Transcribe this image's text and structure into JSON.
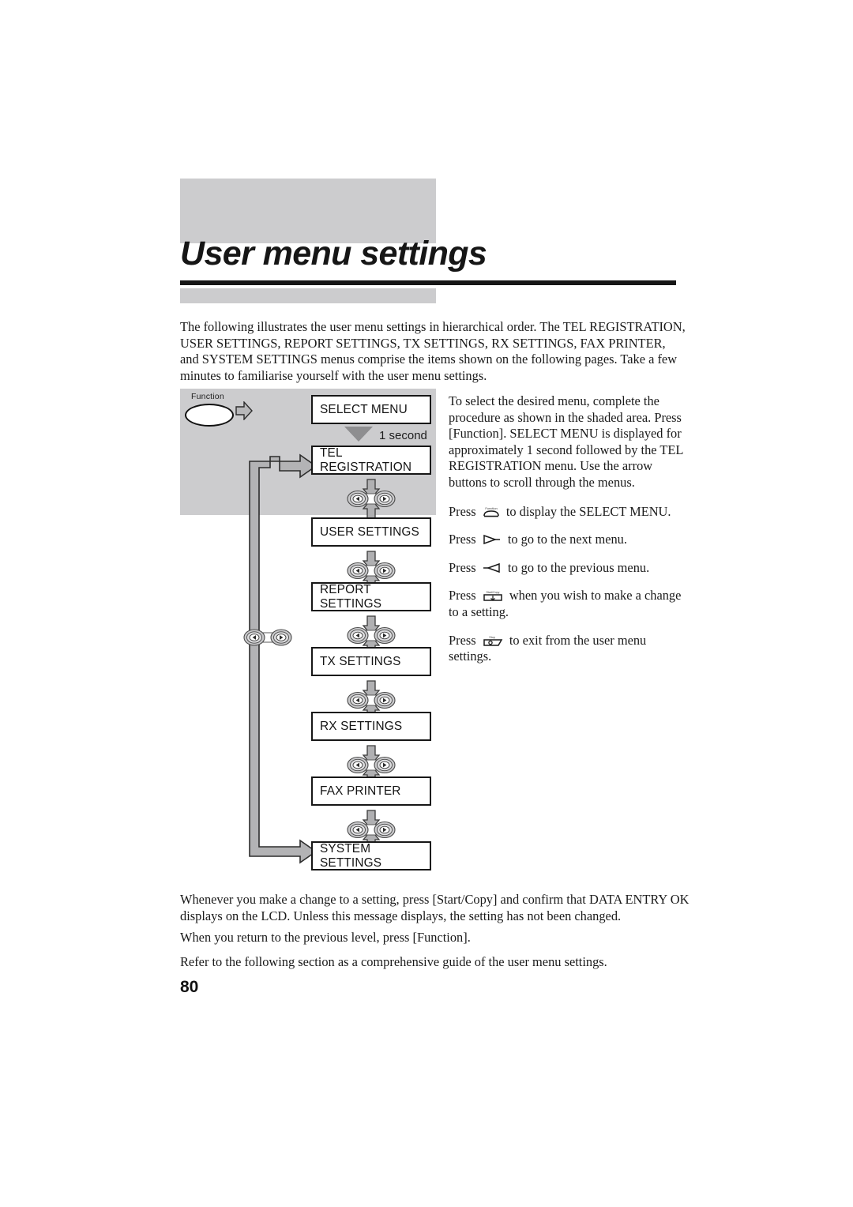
{
  "page": {
    "title": "User menu settings",
    "number": "80"
  },
  "intro": {
    "text": "The following illustrates the user menu settings in hierarchical order. The TEL REGISTRATION, USER SETTINGS, REPORT SETTINGS, TX SETTINGS, RX SETTINGS, FAX PRINTER, and SYSTEM SETTINGS menus comprise the items shown on the following pages. Take a few minutes to familiarise yourself with the user menu settings."
  },
  "diagram": {
    "function_key_label": "Function",
    "delay_label": "1 second",
    "first_display": "SELECT MENU",
    "menus": [
      {
        "label": "TEL REGISTRATION"
      },
      {
        "label": "USER SETTINGS"
      },
      {
        "label": "REPORT SETTINGS"
      },
      {
        "label": "TX SETTINGS"
      },
      {
        "label": "RX SETTINGS"
      },
      {
        "label": "FAX PRINTER"
      },
      {
        "label": "SYSTEM SETTINGS"
      }
    ]
  },
  "instructions": {
    "intro_paragraph": "To select the desired menu, complete the procedure as shown in the shaded area. Press [Function]. SELECT MENU is displayed for approximately 1 second followed by the TEL REGISTRATION menu. Use the arrow buttons to scroll through the menus.",
    "steps": [
      {
        "prefix": "Press",
        "icon": "function-key-icon",
        "suffix": "to display the SELECT MENU."
      },
      {
        "prefix": "Press",
        "icon": "right-arrow-key-icon",
        "suffix": "to go to the next menu."
      },
      {
        "prefix": "Press",
        "icon": "left-arrow-key-icon",
        "suffix": "to go to the previous menu."
      },
      {
        "prefix": "Press",
        "icon": "start-copy-key-icon",
        "suffix": "when you wish to make a change to a setting."
      },
      {
        "prefix": "Press",
        "icon": "stop-key-icon",
        "suffix": "to exit from the user menu settings."
      }
    ]
  },
  "closing": {
    "paragraph_1": "Whenever you make a change to a setting, press [Start/Copy] and confirm that DATA ENTRY OK displays on the LCD. Unless this message displays, the setting has not been changed.",
    "paragraph_2": "When you return to the previous level, press [Function].",
    "paragraph_3": "Refer to the following section as a comprehensive guide of the user menu settings."
  },
  "colors": {
    "shade_gray": "#ccccce",
    "connector_gray": "#9a9a9c",
    "ink": "#1a1a1a"
  }
}
